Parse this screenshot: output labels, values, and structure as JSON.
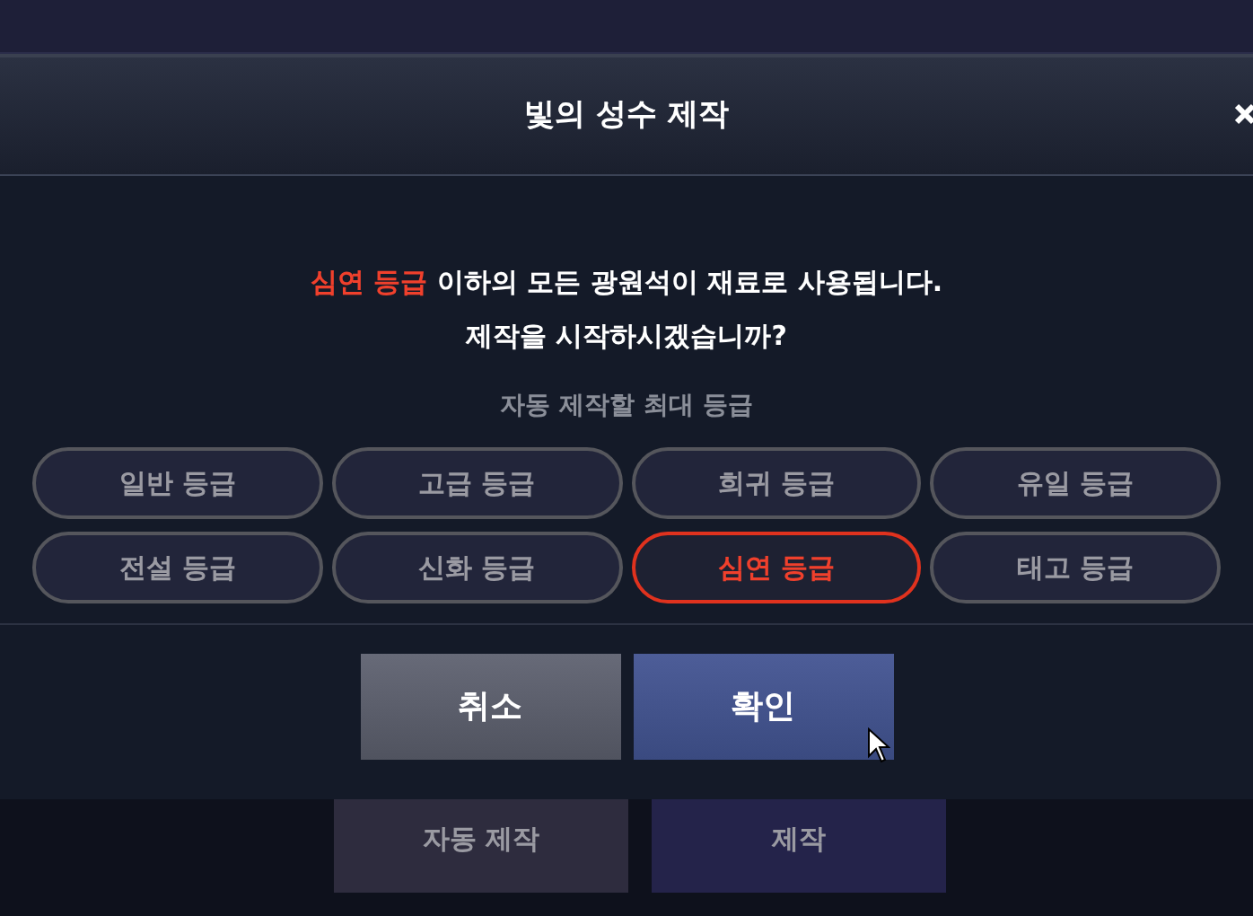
{
  "dialog": {
    "title": "빛의 성수 제작",
    "message": {
      "highlight": "심연 등급",
      "text": " 이하의 모든 광원석이 재료로 사용됩니다.",
      "line2": "제작을 시작하시겠습니까?"
    },
    "grade_label": "자동 제작할 최대 등급",
    "grades": [
      {
        "label": "일반 등급",
        "selected": false
      },
      {
        "label": "고급 등급",
        "selected": false
      },
      {
        "label": "희귀 등급",
        "selected": false
      },
      {
        "label": "유일 등급",
        "selected": false
      },
      {
        "label": "전설 등급",
        "selected": false
      },
      {
        "label": "신화 등급",
        "selected": false
      },
      {
        "label": "심연 등급",
        "selected": true
      },
      {
        "label": "태고 등급",
        "selected": false
      }
    ],
    "buttons": [
      {
        "label": "취소",
        "kind": "cancel"
      },
      {
        "label": "확인",
        "kind": "confirm"
      }
    ]
  },
  "background_buttons": [
    {
      "label": "자동 제작",
      "kind": "auto"
    },
    {
      "label": "제작",
      "kind": "craft"
    }
  ]
}
